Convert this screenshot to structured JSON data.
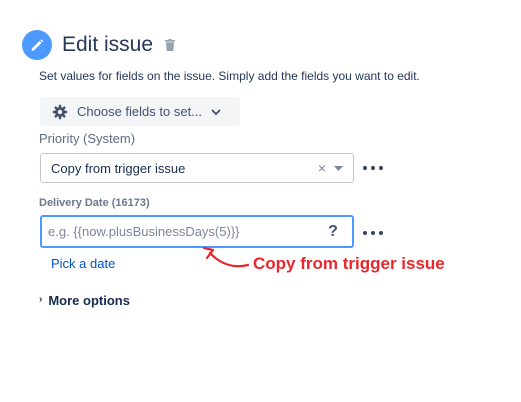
{
  "header": {
    "title": "Edit issue",
    "icon": "pencil-icon",
    "delete_icon": "trash-icon",
    "accent": "#4c9aff"
  },
  "description": "Set values for fields on the issue. Simply add the fields you want to edit.",
  "choose_fields": {
    "label": "Choose fields to set...",
    "icon": "gear-icon"
  },
  "priority": {
    "label": "Priority (System)",
    "value": "Copy from trigger issue",
    "clear": "×"
  },
  "delivery_date": {
    "label": "Delivery Date (16173)",
    "placeholder": "e.g. {{now.plusBusinessDays(5)}}",
    "value": "",
    "help": "?",
    "pick_date": "Pick a date"
  },
  "more_options": "More options",
  "annotation": {
    "text": "Copy from trigger issue",
    "color": "#e8262b"
  }
}
